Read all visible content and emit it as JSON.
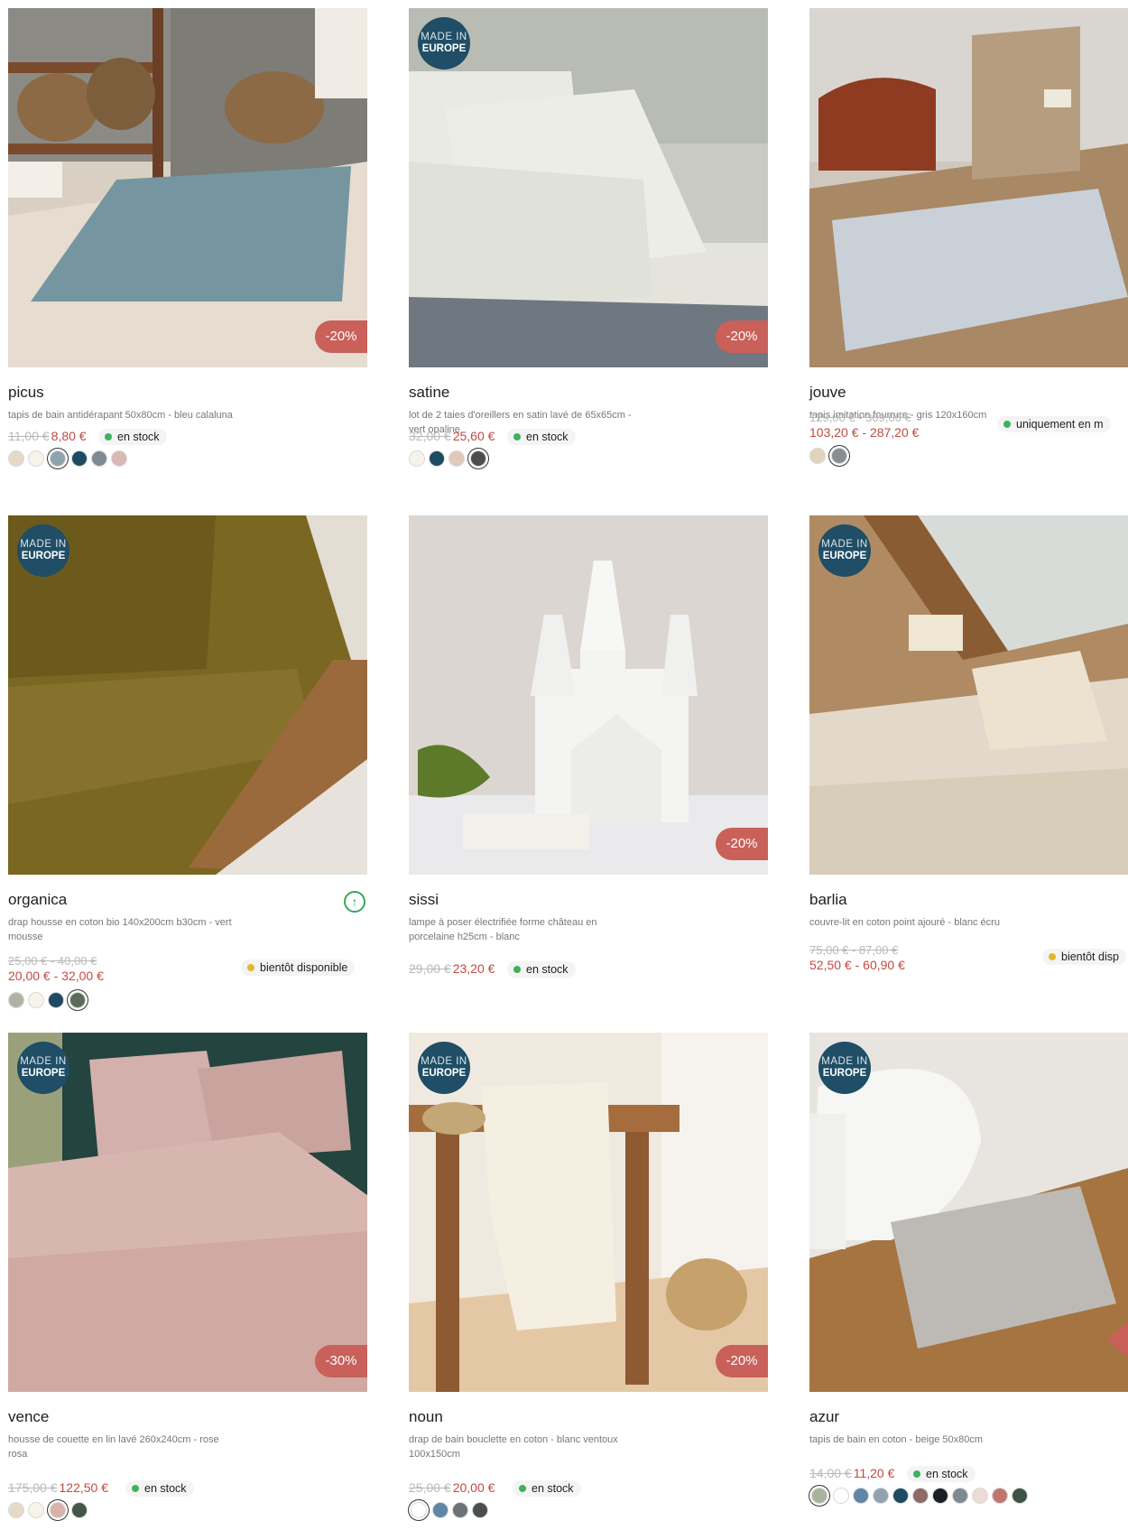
{
  "products": [
    {
      "name": "picus",
      "desc": "tapis de bain antidérapant 50x80cm - bleu calaluna",
      "old_price": "11,00 €",
      "new_price": "8,80 €",
      "stock": "en stock",
      "stock_color": "#3cb35a",
      "discount": "-20%",
      "made_in_europe": false,
      "swatches": [
        "#e7d9c8",
        "#f6f3ea",
        "#8fa3ad",
        "#1e4a63",
        "#7d8a92",
        "#d8b9b4"
      ],
      "selected_swatch": 2
    },
    {
      "name": "satine",
      "desc": "lot de 2 taies d'oreillers en satin lavé de 65x65cm - vert opaline",
      "old_price": "32,00 €",
      "new_price": "25,60 €",
      "stock": "en stock",
      "stock_color": "#3cb35a",
      "discount": "-20%",
      "made_in_europe": true,
      "swatches": [
        "#f6f3ea",
        "#1e4a63",
        "#e0c9bc",
        "#4a4e4c"
      ],
      "selected_swatch": 3
    },
    {
      "name": "jouve",
      "desc": "tapis imitation fourrure - gris 120x160cm",
      "old_price": "129,00 € - 309,00 €",
      "new_price": "103,20 € - 287,20 €",
      "stock": "uniquement en m",
      "stock_color": "#3cb35a",
      "discount": "",
      "made_in_europe": false,
      "swatches": [
        "#e2d3be",
        "#8a8e90"
      ],
      "selected_swatch": 1
    },
    {
      "name": "organica",
      "desc": "drap housse en coton bio 140x200cm b30cm - vert mousse",
      "old_price": "25,00 € - 40,00 €",
      "new_price": "20,00 € - 32,00 €",
      "stock": "bientôt disponible",
      "stock_color": "#e2b72a",
      "discount": "",
      "made_in_europe": true,
      "swatches": [
        "#aeb3a4",
        "#f6f3ea",
        "#1e4a63",
        "#5d6b5a"
      ],
      "selected_swatch": 3
    },
    {
      "name": "sissi",
      "desc": "lampe à poser électrifiée forme château en porcelaine h25cm - blanc",
      "old_price": "29,00 €",
      "new_price": "23,20 €",
      "stock": "en stock",
      "stock_color": "#3cb35a",
      "discount": "-20%",
      "made_in_europe": false,
      "swatches": [],
      "selected_swatch": -1
    },
    {
      "name": "barlia",
      "desc": "couvre-lit en coton point ajouré - blanc écru",
      "old_price": "75,00 € - 87,00 €",
      "new_price": "52,50 € - 60,90 €",
      "stock": "bientôt disp",
      "stock_color": "#e2b72a",
      "discount": "",
      "made_in_europe": true,
      "swatches": [],
      "selected_swatch": -1
    },
    {
      "name": "vence",
      "desc": "housse de couette en lin lavé 260x240cm - rose rosa",
      "old_price": "175,00 €",
      "new_price": "122,50 €",
      "stock": "en stock",
      "stock_color": "#3cb35a",
      "discount": "-30%",
      "made_in_europe": true,
      "swatches": [
        "#e7d9c8",
        "#f6f3ea",
        "#d9b3ab",
        "#44564a"
      ],
      "selected_swatch": 2
    },
    {
      "name": "noun",
      "desc": "drap de bain bouclette en coton - blanc ventoux 100x150cm",
      "old_price": "25,00 €",
      "new_price": "20,00 €",
      "stock": "en stock",
      "stock_color": "#3cb35a",
      "discount": "-20%",
      "made_in_europe": true,
      "swatches": [
        "#ffffff",
        "#5f86a6",
        "#6c7376",
        "#4a4e4c"
      ],
      "selected_swatch": 0
    },
    {
      "name": "azur",
      "desc": "tapis de bain en coton - beige 50x80cm",
      "old_price": "14,00 €",
      "new_price": "11,20 €",
      "stock": "en stock",
      "stock_color": "#3cb35a",
      "discount": "",
      "made_in_europe": true,
      "swatches": [
        "#a9b39c",
        "#ffffff",
        "#5f86a6",
        "#8fa3ad",
        "#1e4a63",
        "#8d6c67",
        "#1b1f24",
        "#7d8a92",
        "#ecdcd8",
        "#c07670",
        "#3e5347"
      ],
      "selected_swatch": 0
    }
  ],
  "europe_badge": {
    "line1": "MADE IN",
    "line2": "EUROPE"
  }
}
